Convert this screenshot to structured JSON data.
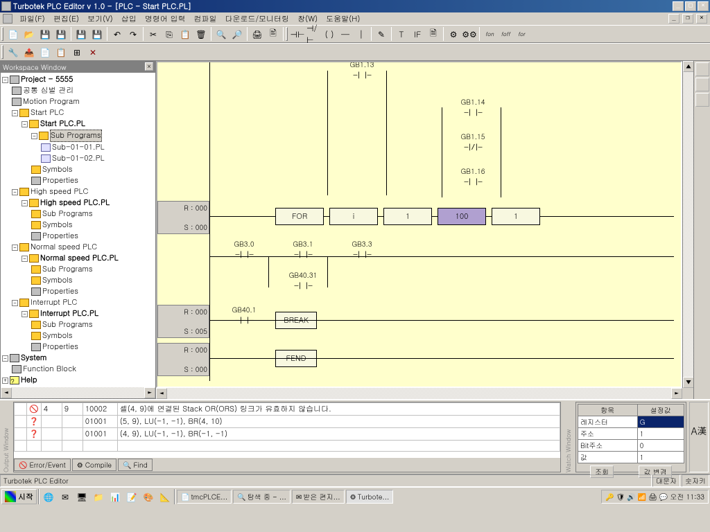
{
  "titlebar": {
    "title": "Turbotek PLC Editor v 1.0 - [PLC  - Start PLC.PL]"
  },
  "menu": [
    "파일(F)",
    "편집(E)",
    "보기(V)",
    "삽입",
    "명령어 입력",
    "컴파일",
    "다운로드/모니터링",
    "창(W)",
    "도움말(H)"
  ],
  "workspace": {
    "title": "Workspace Window",
    "project": "Project - 5555",
    "tree": {
      "n0": "공통 심벌 관리",
      "n1": "Motion Program",
      "n2": "Start PLC",
      "n2a": "Start PLC.PL",
      "n2a1": "Sub Programs",
      "n2a1a": "Sub-01-01.PL",
      "n2a1b": "Sub-01-02.PL",
      "n2a2": "Symbols",
      "n2a3": "Properties",
      "n3": "High speed PLC",
      "n3a": "High speed PLC.PL",
      "n4": "Normal speed PLC",
      "n4a": "Normal speed PLC.PL",
      "n5": "Interrupt PLC",
      "n5a": "Interrupt PLC.PL",
      "sub_programs": "Sub Programs",
      "symbols": "Symbols",
      "properties": "Properties",
      "system": "System",
      "fblock": "Function Block",
      "help": "Help"
    }
  },
  "ladder": {
    "labels": {
      "gb113": "GB1.13",
      "gb114": "GB1.14",
      "gb115": "GB1.15",
      "gb116": "GB1.16",
      "gb30": "GB3.0",
      "gb31": "GB3.1",
      "gb33": "GB3.3",
      "gb4031": "GB40.31",
      "gb401": "GB40.1"
    },
    "rung1": {
      "r": "R : 000",
      "s": "S : 000"
    },
    "rung2": {
      "r": "R : 000",
      "s": "S : 005"
    },
    "rung3": {
      "r": "R : 000",
      "s": "S : 000"
    },
    "for_row": {
      "for": "FOR",
      "i": "i",
      "v1": "1",
      "v100": "100",
      "v1b": "1"
    },
    "break": "BREAK",
    "fend": "FEND"
  },
  "output": {
    "tabs": {
      "error": "Error/Event",
      "compile": "Compile",
      "find": "Find"
    },
    "rows": [
      {
        "icon": "🚫",
        "c1": "4",
        "c2": "9",
        "c3": "10002",
        "msg": "셀(4, 9)에 연결된 Stack OR(ORS) 링크가 유효하지 않습니다."
      },
      {
        "icon": "?",
        "c1": "",
        "c2": "",
        "c3": "01001",
        "msg": "(5, 9), LU(-1, -1), BR(4, 10)"
      },
      {
        "icon": "?",
        "c1": "",
        "c2": "",
        "c3": "01001",
        "msg": "(4, 9), LU(-1, -1), BR(-1, -1)"
      }
    ]
  },
  "watch": {
    "head1": "항목",
    "head2": "설정값",
    "r1a": "레지스터",
    "r1b": "G",
    "r2a": "주소",
    "r2b": "1",
    "r3a": "Bit주소",
    "r3b": "0",
    "r4a": "값",
    "r4b": "1",
    "btn1": "조회",
    "btn2": "값 변경"
  },
  "status": {
    "main": "Turbotek PLC Editor",
    "s1": "대문자",
    "s2": "숫자키",
    "s3": "A漢"
  },
  "taskbar": {
    "start": "시작",
    "tasks": [
      "tmcPLCE...",
      "탐색 중 - ...",
      "받은 편지...",
      "Turbote..."
    ],
    "time": "오전 11:33"
  }
}
